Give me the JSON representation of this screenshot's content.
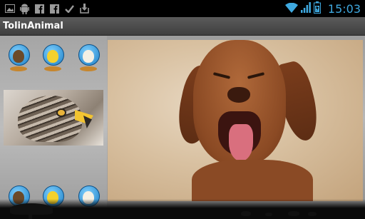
{
  "status_bar": {
    "time": "15:03",
    "icons": [
      "gallery-icon",
      "android-icon",
      "facebook-icon",
      "facebook-icon",
      "check-icon",
      "download-icon"
    ],
    "right_icons": [
      "wifi-icon",
      "signal-icon",
      "battery-icon"
    ],
    "accent_color": "#3fa9e0"
  },
  "title_bar": {
    "title": "TolinAnimal"
  },
  "sidebar": {
    "top_thumbnails": [
      "eagle-character-icon",
      "chick-character-icon",
      "rooster-character-icon"
    ],
    "bottom_thumbnails": [
      "eagle-character-icon",
      "chick-character-icon",
      "rooster-character-icon"
    ]
  },
  "main_image": {
    "subject": "puppy"
  },
  "colors": {
    "background_gray": "#b0b0b0",
    "title_bar": "#4a4a4a"
  }
}
